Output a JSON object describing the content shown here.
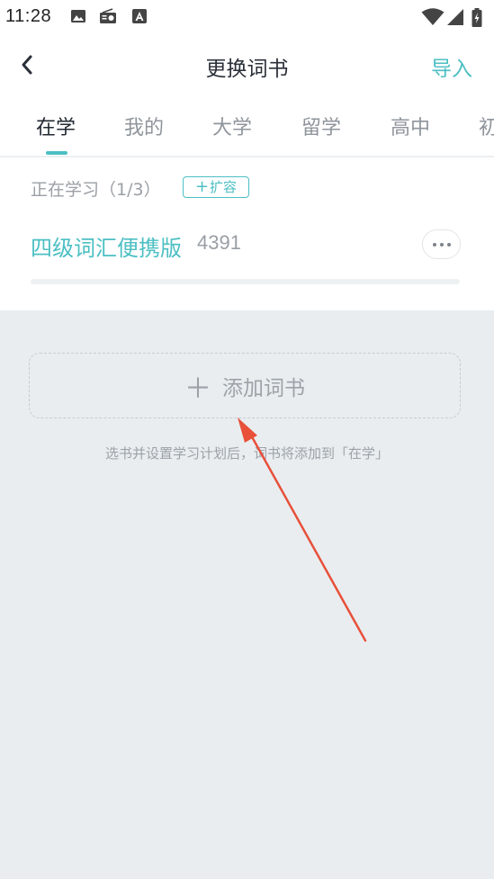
{
  "status_bar": {
    "time": "11:28"
  },
  "header": {
    "title": "更换词书",
    "import_label": "导入"
  },
  "tabs": [
    {
      "label": "在学",
      "active": true
    },
    {
      "label": "我的",
      "active": false
    },
    {
      "label": "大学",
      "active": false
    },
    {
      "label": "留学",
      "active": false
    },
    {
      "label": "高中",
      "active": false
    },
    {
      "label": "初",
      "active": false
    }
  ],
  "studying": {
    "label": "正在学习（1/3）",
    "expand_label": "扩容",
    "book": {
      "name": "四级词汇便携版",
      "word_count": "4391",
      "progress": 0
    }
  },
  "add_book": {
    "label": "添加词书",
    "hint": "选书并设置学习计划后，词书将添加到「在学」"
  },
  "colors": {
    "accent": "#4cbfc3",
    "background": "#e9edf0",
    "annotation_arrow": "#e8503a"
  },
  "icons": {
    "back": "chevron-left-icon",
    "more": "more-dots-icon",
    "add": "plus-icon"
  }
}
